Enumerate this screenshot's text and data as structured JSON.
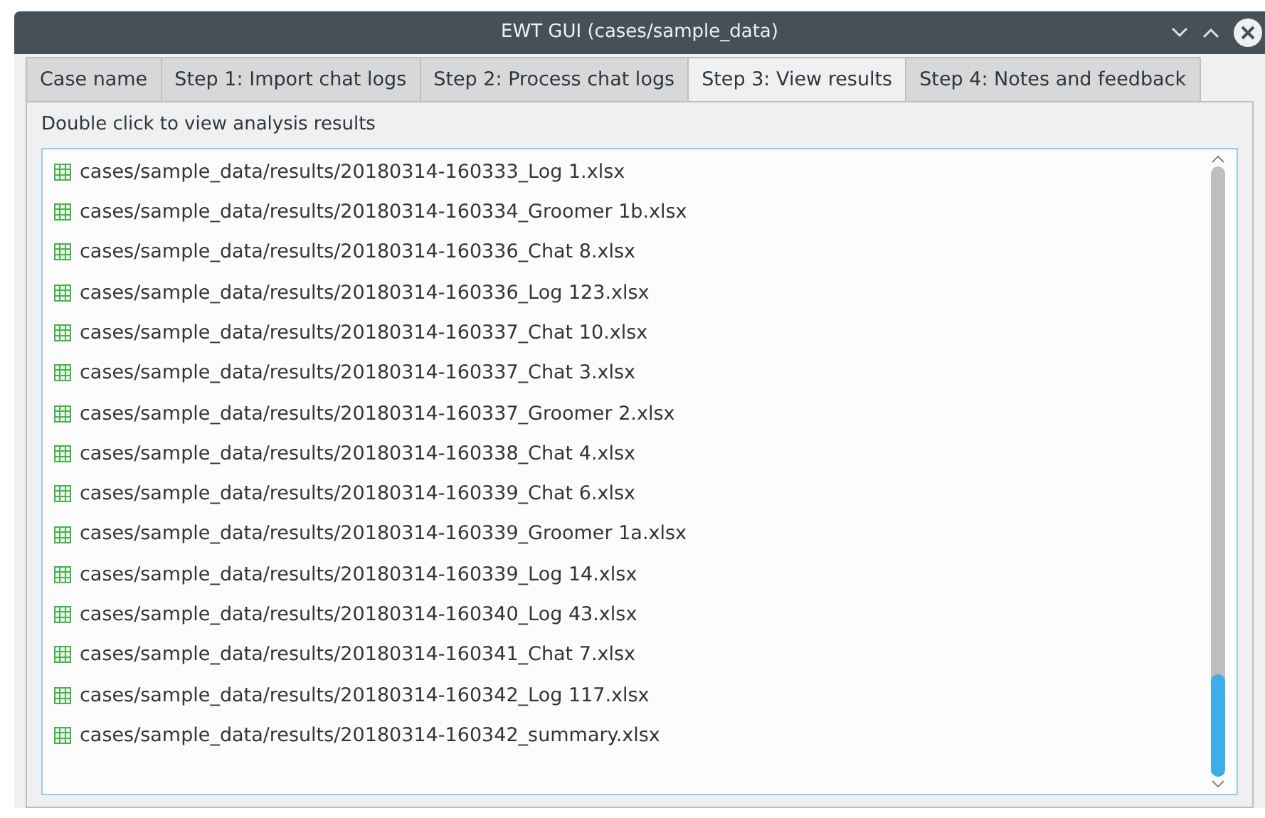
{
  "window": {
    "title": "EWT GUI (cases/sample_data)"
  },
  "tabs": [
    {
      "label": "Case name",
      "selected": false
    },
    {
      "label": "Step 1: Import chat logs",
      "selected": false
    },
    {
      "label": "Step 2: Process chat logs",
      "selected": false
    },
    {
      "label": "Step 3: View results",
      "selected": true
    },
    {
      "label": "Step 4: Notes and feedback",
      "selected": false
    }
  ],
  "instruction": "Double click to view analysis results",
  "files": [
    "cases/sample_data/results/20180314-160333_Log 1.xlsx",
    "cases/sample_data/results/20180314-160334_Groomer 1b.xlsx",
    "cases/sample_data/results/20180314-160336_Chat 8.xlsx",
    "cases/sample_data/results/20180314-160336_Log 123.xlsx",
    "cases/sample_data/results/20180314-160337_Chat 10.xlsx",
    "cases/sample_data/results/20180314-160337_Chat 3.xlsx",
    "cases/sample_data/results/20180314-160337_Groomer 2.xlsx",
    "cases/sample_data/results/20180314-160338_Chat 4.xlsx",
    "cases/sample_data/results/20180314-160339_Chat 6.xlsx",
    "cases/sample_data/results/20180314-160339_Groomer 1a.xlsx",
    "cases/sample_data/results/20180314-160339_Log 14.xlsx",
    "cases/sample_data/results/20180314-160340_Log 43.xlsx",
    "cases/sample_data/results/20180314-160341_Chat 7.xlsx",
    "cases/sample_data/results/20180314-160342_Log 117.xlsx",
    "cases/sample_data/results/20180314-160342_summary.xlsx"
  ]
}
